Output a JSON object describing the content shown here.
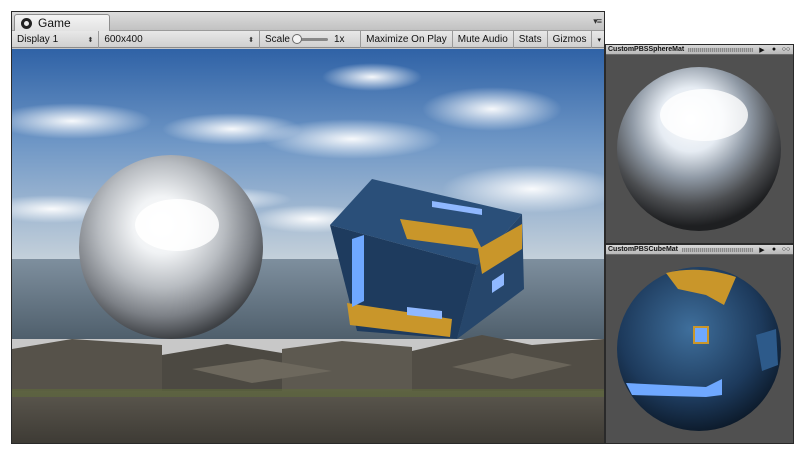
{
  "window": {
    "tab_title": "Game",
    "menu_icon": "window-menu-icon"
  },
  "toolbar": {
    "display": "Display 1",
    "resolution": "600x400",
    "scale_label": "Scale",
    "scale_value": "1x",
    "maximize_on_play": "Maximize On Play",
    "mute_audio": "Mute Audio",
    "stats": "Stats",
    "gizmos": "Gizmos"
  },
  "previews": [
    {
      "title": "CustomPBSSphereMat",
      "mesh": "sphere"
    },
    {
      "title": "CustomPBSCubeMat",
      "mesh": "sphere"
    }
  ],
  "colors": {
    "sky_top": "#3f73b4",
    "sky_horizon": "#b9c9d8",
    "sea": "#5d6f80",
    "rock": "#5e5a52",
    "cube_blue": "#264b73",
    "cube_gold": "#c9962a",
    "glow": "#6fa8ff"
  }
}
